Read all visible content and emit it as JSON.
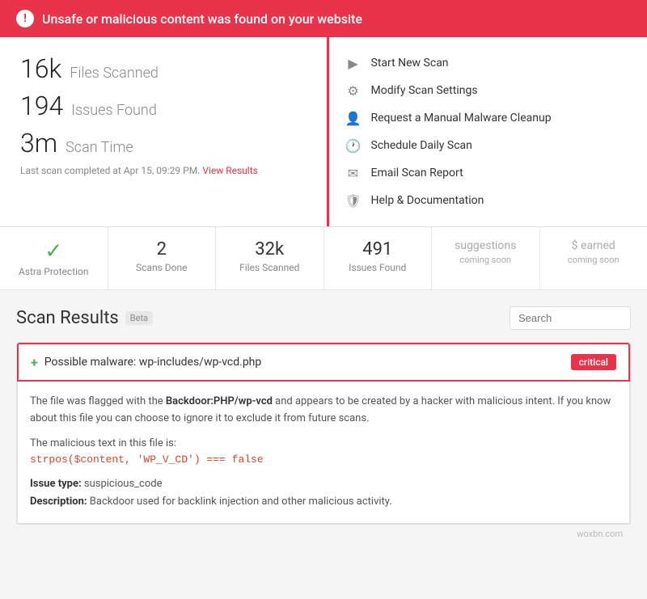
{
  "alert": {
    "icon": "!",
    "message": "Unsafe or malicious content was found on your website"
  },
  "stats": {
    "files_scanned_value": "16k",
    "files_scanned_label": "Files Scanned",
    "issues_found_value": "194",
    "issues_found_label": "Issues Found",
    "scan_time_value": "3m",
    "scan_time_label": "Scan Time",
    "last_scan_text": "Last scan completed at Apr 15, 09:29 PM.",
    "view_results_link": "View Results"
  },
  "actions": [
    {
      "icon": "▶",
      "label": "Start New Scan"
    },
    {
      "icon": "⚙",
      "label": "Modify Scan Settings"
    },
    {
      "icon": "👤",
      "label": "Request a Manual Malware Cleanup"
    },
    {
      "icon": "🕐",
      "label": "Schedule Daily Scan"
    },
    {
      "icon": "✉",
      "label": "Email Scan Report"
    },
    {
      "icon": "🛡",
      "label": "Help & Documentation"
    }
  ],
  "stats_bar": {
    "items": [
      {
        "value": "✓",
        "label": "Astra Protection",
        "type": "green"
      },
      {
        "value": "2",
        "label": "Scans Done",
        "type": "normal"
      },
      {
        "value": "32k",
        "label": "Files Scanned",
        "type": "normal"
      },
      {
        "value": "491",
        "label": "Issues Found",
        "type": "normal"
      },
      {
        "value": "suggestions",
        "label": "coming soon",
        "type": "coming-soon"
      },
      {
        "value": "$ earned",
        "label": "coming soon",
        "type": "coming-soon"
      }
    ]
  },
  "scan_results": {
    "title": "Scan Results",
    "beta_label": "Beta",
    "search_placeholder": "Search"
  },
  "malware_item": {
    "title": "Possible malware: wp-includes/wp-vcd.php",
    "severity": "critical",
    "description_part1": "The file was flagged with the ",
    "description_bold": "Backdoor:PHP/wp-vcd",
    "description_part2": " and appears to be created by a hacker with malicious intent. If you know about this file you can choose to ignore it to exclude it from future scans.",
    "malicious_text_label": "The malicious text in this file is:",
    "malicious_code": "strpos($content, 'WP_V_CD') === false",
    "issue_type_label": "Issue type:",
    "issue_type_value": "suspicious_code",
    "description_label": "Description:",
    "description_value": "Backdoor used for backlink injection and other malicious activity."
  },
  "watermark": "woxbn.com"
}
